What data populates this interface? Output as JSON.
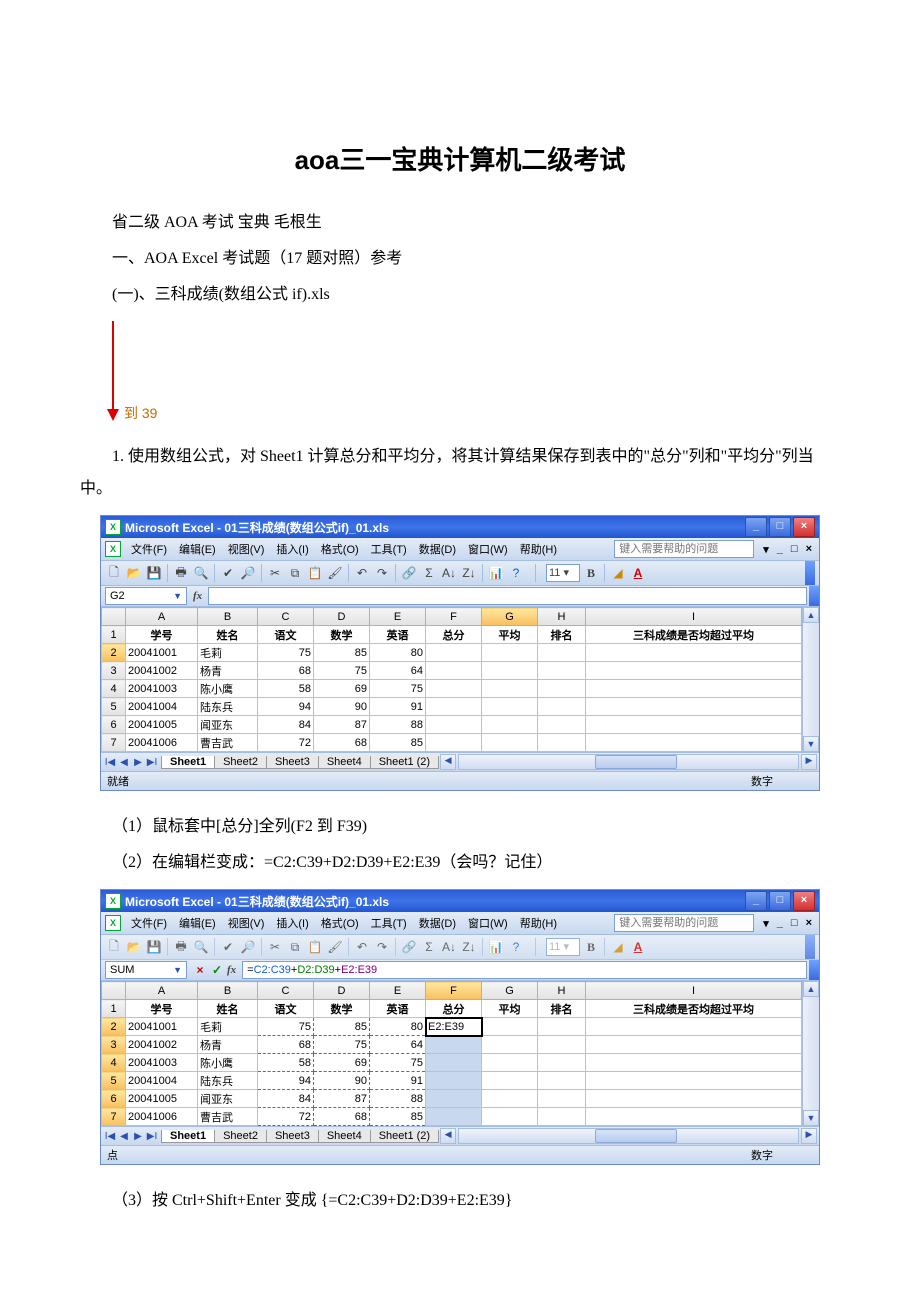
{
  "title": "aoa三一宝典计算机二级考试",
  "intro_lines": [
    "省二级 AOA 考试 宝典 毛根生",
    "一、AOA Excel 考试题（17 题对照）参考",
    "(一)、三科成绩(数组公式 if).xls"
  ],
  "arrow_label": "到 39",
  "task1": "1. 使用数组公式，对 Sheet1 计算总分和平均分，将其计算结果保存到表中的\"总分\"列和\"平均分\"列当中。",
  "step1": "（1）鼠标套中[总分]全列(F2 到 F39)",
  "step2": "（2）在编辑栏变成：=C2:C39+D2:D39+E2:E39（会吗？记住）",
  "step3": "（3）按 Ctrl+Shift+Enter 变成 {=C2:C39+D2:D39+E2:E39}",
  "excel": {
    "window_title": "Microsoft Excel - 01三科成绩(数组公式if)_01.xls",
    "menus": [
      "文件(F)",
      "编辑(E)",
      "视图(V)",
      "插入(I)",
      "格式(O)",
      "工具(T)",
      "数据(D)",
      "窗口(W)",
      "帮助(H)"
    ],
    "help_placeholder": "键入需要帮助的问题",
    "font_size": "11",
    "status_ready": "就绪",
    "status_ime": "数字",
    "headers": [
      "学号",
      "姓名",
      "语文",
      "数学",
      "英语",
      "总分",
      "平均",
      "排名",
      "三科成绩是否均超过平均"
    ],
    "col_letters": [
      "A",
      "B",
      "C",
      "D",
      "E",
      "F",
      "G",
      "H",
      "I"
    ],
    "rows1": [
      {
        "n": 1,
        "header": true
      },
      {
        "n": 2,
        "a": "20041001",
        "b": "毛莉",
        "c": 75,
        "d": 85,
        "e": 80
      },
      {
        "n": 3,
        "a": "20041002",
        "b": "杨青",
        "c": 68,
        "d": 75,
        "e": 64
      },
      {
        "n": 4,
        "a": "20041003",
        "b": "陈小鹰",
        "c": 58,
        "d": 69,
        "e": 75
      },
      {
        "n": 5,
        "a": "20041004",
        "b": "陆东兵",
        "c": 94,
        "d": 90,
        "e": 91
      },
      {
        "n": 6,
        "a": "20041005",
        "b": "闻亚东",
        "c": 84,
        "d": 87,
        "e": 88
      },
      {
        "n": 7,
        "a": "20041006",
        "b": "曹吉武",
        "c": 72,
        "d": 68,
        "e": 85
      }
    ],
    "rows2": [
      {
        "n": 1,
        "header": true
      },
      {
        "n": 2,
        "a": "20041001",
        "b": "毛莉",
        "c": 75,
        "d": 85,
        "e": 80,
        "f": "E2:E39"
      },
      {
        "n": 3,
        "a": "20041002",
        "b": "杨青",
        "c": 68,
        "d": 75,
        "e": 64
      },
      {
        "n": 4,
        "a": "20041003",
        "b": "陈小鹰",
        "c": 58,
        "d": 69,
        "e": 75
      },
      {
        "n": 5,
        "a": "20041004",
        "b": "陆东兵",
        "c": 94,
        "d": 90,
        "e": 91
      },
      {
        "n": 6,
        "a": "20041005",
        "b": "闻亚东",
        "c": 84,
        "d": 87,
        "e": 88
      },
      {
        "n": 7,
        "a": "20041006",
        "b": "曹吉武",
        "c": 72,
        "d": 68,
        "e": 85
      }
    ],
    "sheet_tabs": [
      "Sheet1",
      "Sheet2",
      "Sheet3",
      "Sheet4",
      "Sheet1 (2)"
    ],
    "shot1": {
      "name_box": "G2",
      "formula": "",
      "active_col": "G",
      "status": "就绪"
    },
    "shot2": {
      "name_box": "SUM",
      "formula_parts": [
        {
          "t": "=",
          "c": "black"
        },
        {
          "t": "C2:C39",
          "c": "blue"
        },
        {
          "t": "+",
          "c": "black"
        },
        {
          "t": "D2:D39",
          "c": "green"
        },
        {
          "t": "+",
          "c": "black"
        },
        {
          "t": "E2:E39",
          "c": "purple"
        }
      ],
      "active_col": "F"
    }
  }
}
